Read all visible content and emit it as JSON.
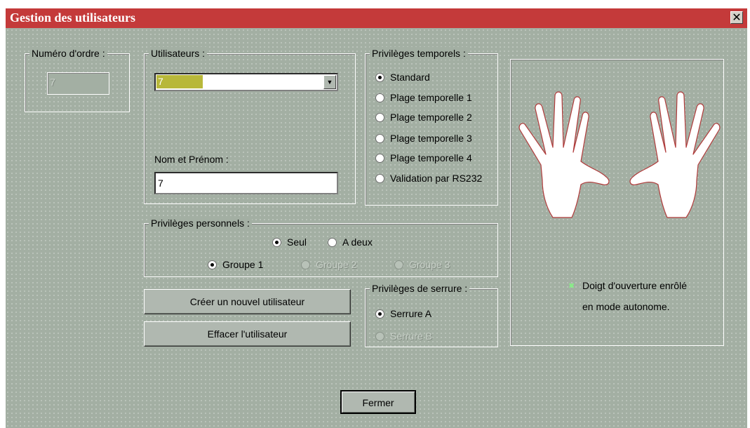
{
  "window": {
    "title": "Gestion des utilisateurs",
    "close_glyph": "✕"
  },
  "order_number": {
    "legend": "Numéro d'ordre :",
    "value": "7"
  },
  "users": {
    "legend": "Utilisateurs :",
    "selected_value": "7",
    "dropdown_arrow": "▼",
    "name_label": "Nom et Prénom :",
    "name_value": "7"
  },
  "temporal_privileges": {
    "legend": "Privilèges temporels :",
    "options": [
      {
        "label": "Standard",
        "checked": true
      },
      {
        "label": "Plage temporelle 1",
        "checked": false
      },
      {
        "label": "Plage temporelle 2",
        "checked": false
      },
      {
        "label": "Plage temporelle 3",
        "checked": false
      },
      {
        "label": "Plage temporelle 4",
        "checked": false
      },
      {
        "label": "Validation par RS232",
        "checked": false
      }
    ]
  },
  "personal_privileges": {
    "legend": "Privilèges personnels :",
    "mode_options": [
      {
        "label": "Seul",
        "checked": true
      },
      {
        "label": "A deux",
        "checked": false
      }
    ],
    "group_options": [
      {
        "label": "Groupe 1",
        "checked": true,
        "enabled": true
      },
      {
        "label": "Groupe 2",
        "checked": false,
        "enabled": false
      },
      {
        "label": "Groupe 3",
        "checked": false,
        "enabled": false
      }
    ]
  },
  "lock_privileges": {
    "legend": "Privilèges de serrure :",
    "options": [
      {
        "label": "Serrure A",
        "checked": true,
        "enabled": true
      },
      {
        "label": "Serrure B",
        "checked": false,
        "enabled": false
      }
    ]
  },
  "buttons": {
    "create_user": "Créer un nouvel utilisateur",
    "delete_user": "Effacer l'utilisateur",
    "close": "Fermer"
  },
  "fingerprint_panel": {
    "marker_glyph": "✖",
    "status_line1": "Doigt d'ouverture enrôlé",
    "status_line2": "en mode autonome."
  },
  "colors": {
    "titlebar": "#c43a3a",
    "client_bg": "#a3afa3",
    "selection_highlight": "#b8b83a",
    "enrolled_marker": "#88ee88",
    "hand_outline": "#b03a3a"
  }
}
